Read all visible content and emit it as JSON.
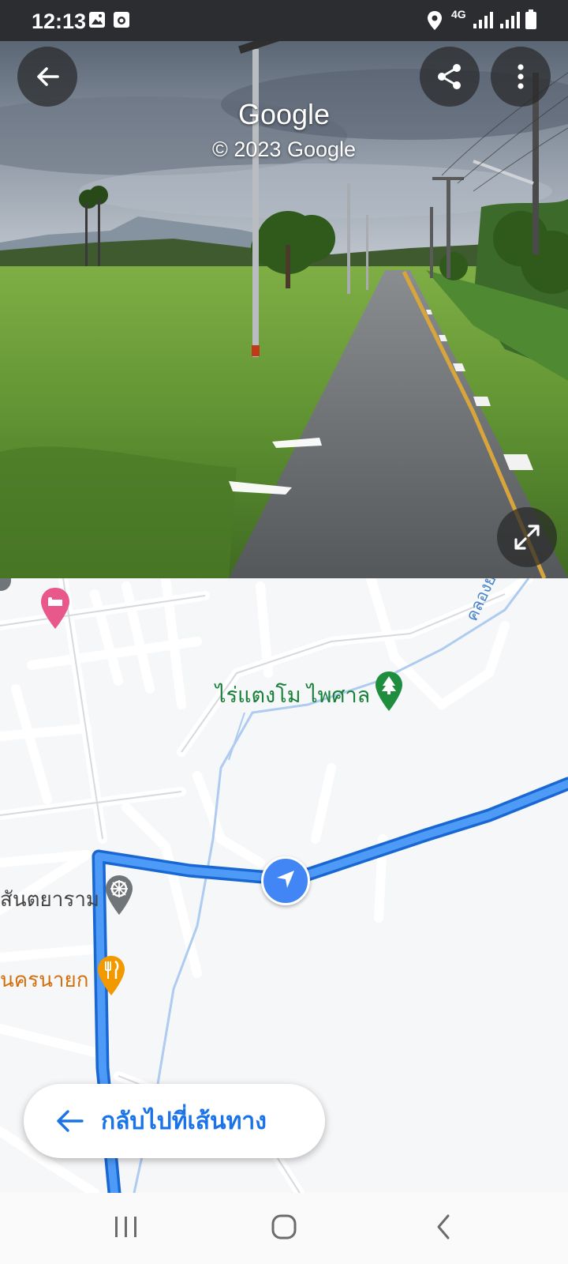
{
  "status_bar": {
    "time": "12:13",
    "network": "4G",
    "icons": [
      "gallery-icon",
      "camera-icon",
      "location-icon",
      "signal-icon",
      "battery-icon"
    ]
  },
  "street_view": {
    "title": "Google",
    "copyright": "© 2023 Google",
    "buttons": {
      "back": "arrow-left-icon",
      "share": "share-icon",
      "more": "more-vert-icon",
      "expand": "expand-icon"
    }
  },
  "map": {
    "places": [
      {
        "name": "ไร่แตงโม ไพศาล",
        "icon": "tree-icon",
        "color": "#188038"
      },
      {
        "name": "สันตยาราม",
        "icon": "dharma-wheel-icon",
        "color": "#5f6368"
      },
      {
        "name": "นครนายก",
        "icon": "restaurant-icon",
        "color": "#e37400"
      },
      {
        "name": "คลองยาง",
        "icon": "",
        "color": "#4a86c8"
      }
    ],
    "hotel_icon": "hotel-icon",
    "route_color": "#1a73e8",
    "back_to_route": {
      "label": "กลับไปที่เส้นทาง",
      "icon": "arrow-left-icon"
    }
  },
  "nav_bar": {
    "recents": "recents-icon",
    "home": "home-icon",
    "back": "back-icon"
  }
}
